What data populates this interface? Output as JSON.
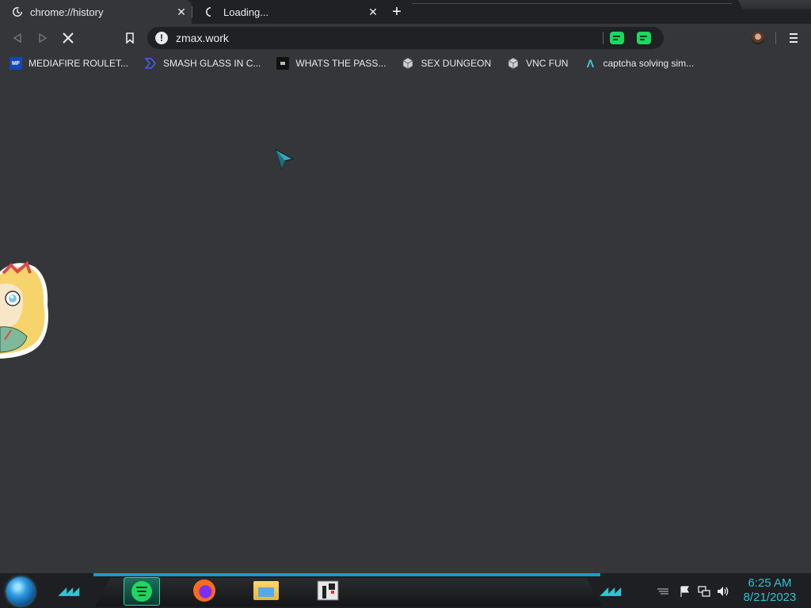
{
  "tabs": [
    {
      "title": "chrome://history",
      "favicon": "history-icon",
      "active": true
    },
    {
      "title": "Loading...",
      "favicon": "loading-spinner-icon",
      "active": false
    }
  ],
  "tab_close_glyph": "✕",
  "new_tab_glyph": "+",
  "omnibox": {
    "url": "zmax.work",
    "info_glyph": "!"
  },
  "bookmarks": [
    {
      "label": "MEDIAFIRE ROULET...",
      "icon": "mediafire-icon",
      "icon_text": "MF"
    },
    {
      "label": "SMASH GLASS IN C...",
      "icon": "chevron-logo-icon",
      "icon_text": ""
    },
    {
      "label": "WHATS THE PASS...",
      "icon": "dark-site-icon",
      "icon_text": ""
    },
    {
      "label": "SEX DUNGEON",
      "icon": "cube-icon",
      "icon_text": ""
    },
    {
      "label": "VNC FUN",
      "icon": "cube-icon",
      "icon_text": ""
    },
    {
      "label": "captcha solving sim...",
      "icon": "lambda-icon",
      "icon_text": "Λ"
    }
  ],
  "clock": {
    "time": "6:25 AM",
    "date": "8/21/2023"
  },
  "colors": {
    "accent": "#2ec3d8",
    "spotify": "#1ed760",
    "background": "#35363a"
  }
}
